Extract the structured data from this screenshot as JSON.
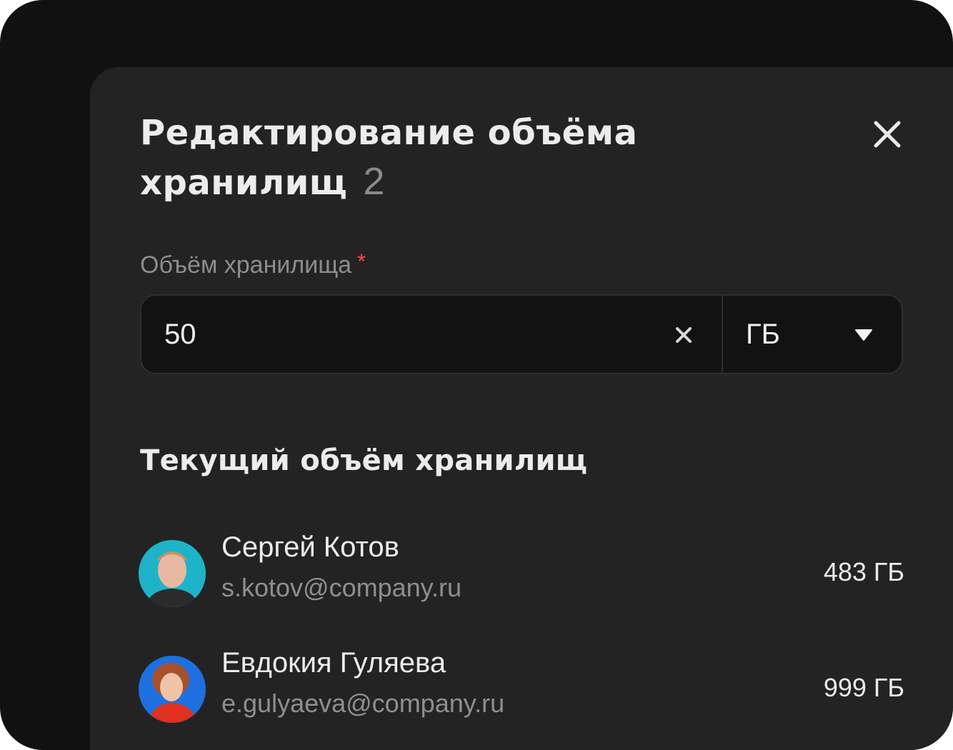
{
  "dialog": {
    "title": "Редактирование объёма хранилищ",
    "count": "2",
    "close_icon": "close-icon"
  },
  "field": {
    "label": "Объём хранилища",
    "required_mark": "*",
    "value": "50",
    "clear_icon": "clear-icon",
    "unit": "ГБ",
    "unit_icon": "triangle-down-icon"
  },
  "current": {
    "title": "Текущий объём хранилищ",
    "users": [
      {
        "name": "Сергей Котов",
        "email": "s.kotov@company.ru",
        "size": "483 ГБ",
        "avatar_bg": "#1fb3c9"
      },
      {
        "name": "Евдокия Гуляева",
        "email": "e.gulyaeva@company.ru",
        "size": "999 ГБ",
        "avatar_bg": "#1e6fe0"
      }
    ]
  },
  "colors": {
    "background": "#111111",
    "dialog": "#232323",
    "input": "#121212",
    "required": "#ff4a4a"
  }
}
